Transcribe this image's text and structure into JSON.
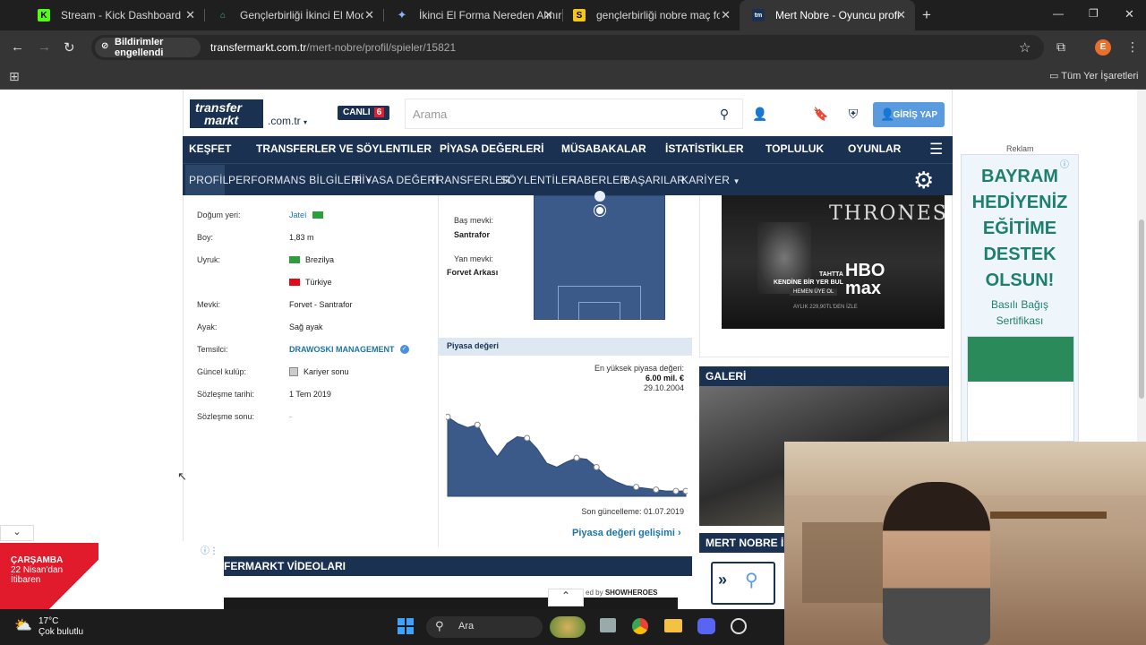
{
  "browser": {
    "tabs": [
      {
        "title": "Stream - Kick Dashboard",
        "icon": "kick-icon"
      },
      {
        "title": "Gençlerbirliği İkinci El Modelleri",
        "icon": "bag-icon"
      },
      {
        "title": "İkinci El Forma Nereden Alınır?",
        "icon": "gemini-icon"
      },
      {
        "title": "gençlerbirliği nobre maç forması",
        "icon": "s-icon"
      },
      {
        "title": "Mert Nobre - Oyuncu profili | Tr",
        "icon": "tm-icon"
      }
    ],
    "notif_chip": "Bildirimler engellendi",
    "url_host": "transfermarkt.com.tr",
    "url_path": "/mert-nobre/profil/spieler/15821",
    "bookmarks_label": "Tüm Yer İşaretleri",
    "profile_initial": "E"
  },
  "tm": {
    "logo_line1": "transfer",
    "logo_line2": "markt",
    "domain": ".com.tr",
    "live_label": "CANLI",
    "live_count": "6",
    "search_placeholder": "Arama",
    "login_label": "GİRİŞ YAP",
    "main_nav": [
      "KEŞFET",
      "TRANSFERLER VE SÖYLENTILER",
      "PİYASA DEĞERLERİ",
      "MÜSABAKALAR",
      "İSTATİSTİKLER",
      "TOPLULUK",
      "OYUNLAR"
    ],
    "sub_nav": [
      "PROFİL",
      "PERFORMANS BİLGİLERİ",
      "PİYASA DEĞERİ",
      "TRANSFERLER",
      "SÖYLENTİLER",
      "HABERLER",
      "BAŞARILAR",
      "KARİYER"
    ]
  },
  "profile": {
    "rows": [
      {
        "label": "Doğum yeri:",
        "value": "Jateí"
      },
      {
        "label": "Boy:",
        "value": "1,83 m"
      },
      {
        "label": "Uyruk:",
        "value": "Brezilya"
      },
      {
        "label": "",
        "value": "Türkiye"
      },
      {
        "label": "Mevki:",
        "value": "Forvet - Santrafor"
      },
      {
        "label": "Ayak:",
        "value": "Sağ ayak"
      },
      {
        "label": "Temsilci:",
        "value": "DRAWOSKI MANAGEMENT"
      },
      {
        "label": "Güncel kulüp:",
        "value": "Kariyer sonu"
      },
      {
        "label": "Sözleşme tarihi:",
        "value": "1 Tem 2019"
      },
      {
        "label": "Sözleşme sonu:",
        "value": "-"
      }
    ],
    "main_pos_label": "Baş mevki:",
    "main_pos": "Santrafor",
    "side_pos_label": "Yan mevki:",
    "side_pos": "Forvet Arkası"
  },
  "market": {
    "header": "Piyasa değeri",
    "highest_label": "En yüksek piyasa değeri:",
    "highest_value": "6.00 mil. €",
    "highest_date": "29.10.2004",
    "updated": "Son güncelleme: 01.07.2019",
    "link": "Piyasa değeri gelişimi"
  },
  "chart_data": {
    "type": "area",
    "title": "",
    "values": [
      6.0,
      5.5,
      5.2,
      5.4,
      4.0,
      3.0,
      4.0,
      4.5,
      4.4,
      3.6,
      2.5,
      2.2,
      2.6,
      2.9,
      2.8,
      2.2,
      1.5,
      1.1,
      0.8,
      0.7,
      0.6,
      0.5,
      0.4,
      0.4,
      0.4
    ],
    "ylim": [
      0,
      6.5
    ]
  },
  "sidebar": {
    "reklam": "Reklam",
    "hbo_line1": "TAHTTA",
    "hbo_line2": "KENDİNE BİR YER BUL",
    "hbo_cta": "HEMEN ÜYE OL",
    "hbo_brand": "HBO max",
    "hbo_price": "AYLIK 229,90TL'DEN İZLE",
    "gallery": "GALERİ",
    "mert_head": "MERT NOBRE İLE B",
    "bayram_lines": [
      "BAYRAM",
      "HEDİYENİZ",
      "EĞİTİME",
      "DESTEK",
      "OLSUN!"
    ],
    "bayram_sub": "Basılı Bağış Sertifikası",
    "got_text": "THRONES"
  },
  "videos": {
    "header": "FERMARKT VİDEOLARI",
    "powered": "ed by",
    "brand": "SHOWHEROES"
  },
  "bottom_ad": {
    "day": "ÇARŞAMBA",
    "date": "22 Nisan'dan",
    "sub": "İtibaren"
  },
  "taskbar": {
    "temp": "17°C",
    "weather": "Çok bulutlu",
    "search": "Ara"
  }
}
